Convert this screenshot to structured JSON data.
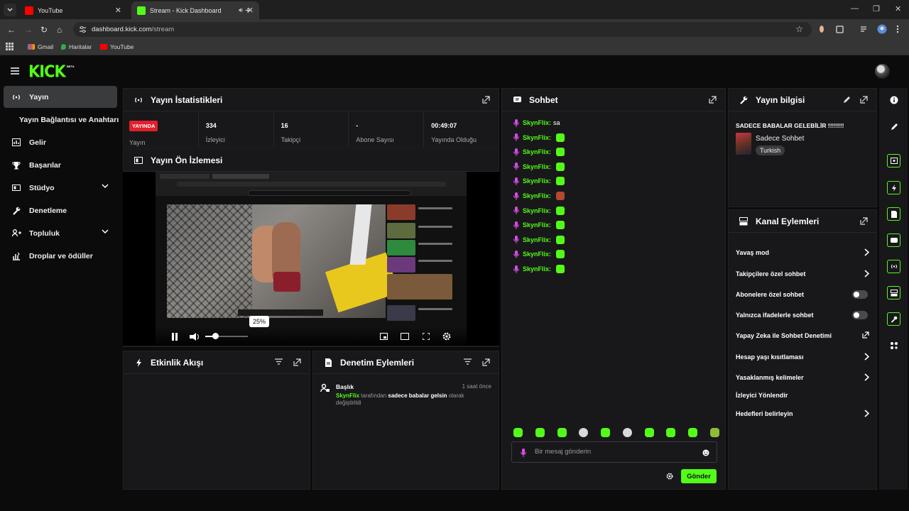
{
  "browser": {
    "tabs": [
      {
        "title": "YouTube",
        "active": false
      },
      {
        "title": "Stream - Kick Dashboard",
        "active": true
      }
    ],
    "url_host": "dashboard.kick.com",
    "url_path": "/stream",
    "bookmarks": [
      "Gmail",
      "Haritalar",
      "YouTube"
    ]
  },
  "app": {
    "logo": "KICK",
    "logo_badge": "BETA"
  },
  "sidebar": {
    "items": [
      {
        "label": "Yayın",
        "icon": "broadcast-icon",
        "active": true
      },
      {
        "label": "Yayın Bağlantısı ve Anahtarı",
        "sub": true
      },
      {
        "label": "Gelir",
        "icon": "revenue-icon"
      },
      {
        "label": "Başarılar",
        "icon": "trophy-icon"
      },
      {
        "label": "Stüdyo",
        "icon": "studio-icon",
        "expandable": true
      },
      {
        "label": "Denetleme",
        "icon": "wrench-icon"
      },
      {
        "label": "Topluluk",
        "icon": "community-icon",
        "expandable": true
      },
      {
        "label": "Droplar ve ödüller",
        "icon": "drops-icon"
      }
    ]
  },
  "stats_panel": {
    "title": "Yayın İstatistikleri",
    "live_badge": "YAYINDA",
    "stats": [
      {
        "value": "",
        "label": "Yayın"
      },
      {
        "value": "334",
        "label": "İzleyici"
      },
      {
        "value": "16",
        "label": "Takipçi"
      },
      {
        "value": "-",
        "label": "Abone Sayısı"
      },
      {
        "value": "00:49:07",
        "label": "Yayında Olduğu"
      }
    ]
  },
  "preview_panel": {
    "title": "Yayın Ön İzlemesi",
    "volume_tooltip": "25%"
  },
  "activity_panel": {
    "title": "Etkinlik Akışı"
  },
  "mod_panel": {
    "title": "Denetim Eylemleri",
    "items": [
      {
        "type": "Başlık",
        "time": "1 saat önce",
        "user": "SkynFlix",
        "text_1": "tarafından",
        "value": "sadece babalar gelsin",
        "text_2": "olarak değiştirildi"
      }
    ]
  },
  "chat_panel": {
    "title": "Sohbet",
    "messages": [
      {
        "user": "SkynFlix:",
        "text": "sa",
        "emote": false
      },
      {
        "user": "SkynFlix:",
        "text": "",
        "emote": true
      },
      {
        "user": "SkynFlix:",
        "text": "",
        "emote": true
      },
      {
        "user": "SkynFlix:",
        "text": "",
        "emote": true
      },
      {
        "user": "SkynFlix:",
        "text": "",
        "emote": true
      },
      {
        "user": "SkynFlix:",
        "text": "",
        "emote": true
      },
      {
        "user": "SkynFlix:",
        "text": "",
        "emote": true
      },
      {
        "user": "SkynFlix:",
        "text": "",
        "emote": true
      },
      {
        "user": "SkynFlix:",
        "text": "",
        "emote": true
      },
      {
        "user": "SkynFlix:",
        "text": "",
        "emote": true
      },
      {
        "user": "SkynFlix:",
        "text": "",
        "emote": true
      }
    ],
    "input_placeholder": "Bir mesaj gönderin",
    "send_label": "Gönder"
  },
  "info_panel": {
    "title": "Yayın bilgisi",
    "stream_title": "SADECE BABALAR GELEBİLİR !!!!!!!!",
    "category": "Sadece Sohbet",
    "tag": "Turkish"
  },
  "channel_actions": {
    "title": "Kanal Eylemleri",
    "items": [
      {
        "label": "Yavaş mod",
        "control": "chevron"
      },
      {
        "label": "Takipçilere özel sohbet",
        "control": "chevron"
      },
      {
        "label": "Abonelere özel sohbet",
        "control": "toggle"
      },
      {
        "label": "Yalnızca ifadelerle sohbet",
        "control": "toggle"
      },
      {
        "label": "Yapay Zeka ile Sohbet Denetimi",
        "control": "external"
      },
      {
        "label": "Hesap yaşı kısıtlaması",
        "control": "chevron"
      },
      {
        "label": "Yasaklanmış kelimeler",
        "control": "chevron"
      },
      {
        "label": "İzleyici Yönlendir",
        "control": "none"
      },
      {
        "label": "Hedefleri belirleyin",
        "control": "chevron"
      }
    ]
  },
  "colors": {
    "accent": "#53fc18",
    "live": "#e0202a",
    "panel": "#18181a"
  }
}
